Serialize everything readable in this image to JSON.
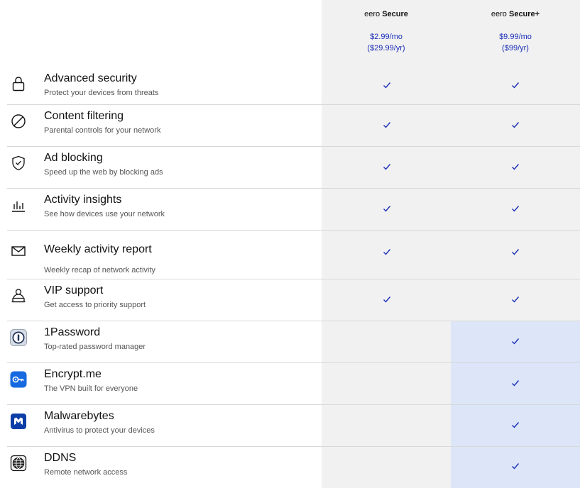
{
  "plans": [
    {
      "brand": "eero",
      "tier": "Secure",
      "price_monthly": "$2.99/mo",
      "price_yearly": "($29.99/yr)"
    },
    {
      "brand": "eero",
      "tier": "Secure+",
      "price_monthly": "$9.99/mo",
      "price_yearly": "($99/yr)"
    }
  ],
  "features": [
    {
      "title": "Advanced security",
      "subtitle": "Protect your devices from threats",
      "icon": "lock-icon"
    },
    {
      "title": "Content filtering",
      "subtitle": "Parental controls for your network",
      "icon": "block-icon"
    },
    {
      "title": "Ad blocking",
      "subtitle": "Speed up the web by blocking ads",
      "icon": "shield-check-icon"
    },
    {
      "title": "Activity insights",
      "subtitle": "See how devices use your network",
      "icon": "bar-chart-icon"
    },
    {
      "title": "Weekly activity report",
      "subtitle": "Weekly recap of network activity",
      "icon": "envelope-icon"
    },
    {
      "title": "VIP support",
      "subtitle": "Get access to priority support",
      "icon": "support-agent-icon"
    },
    {
      "title": "1Password",
      "subtitle": "Top-rated password manager",
      "icon": "1password-logo-icon"
    },
    {
      "title": "Encrypt.me",
      "subtitle": "The VPN built for everyone",
      "icon": "encryptme-logo-icon"
    },
    {
      "title": "Malwarebytes",
      "subtitle": "Antivirus to protect your devices",
      "icon": "malwarebytes-logo-icon"
    },
    {
      "title": "DDNS",
      "subtitle": "Remote network access",
      "icon": "globe-icon"
    }
  ],
  "inclusion": {
    "secure": [
      true,
      true,
      true,
      true,
      true,
      true,
      false,
      false,
      false,
      false
    ],
    "secure_plus": [
      true,
      true,
      true,
      true,
      true,
      true,
      true,
      true,
      true,
      true
    ]
  },
  "colors": {
    "accent": "#1a2eb8",
    "column_bg": "#f1f1f1",
    "highlight_bg": "#dce6f8"
  }
}
